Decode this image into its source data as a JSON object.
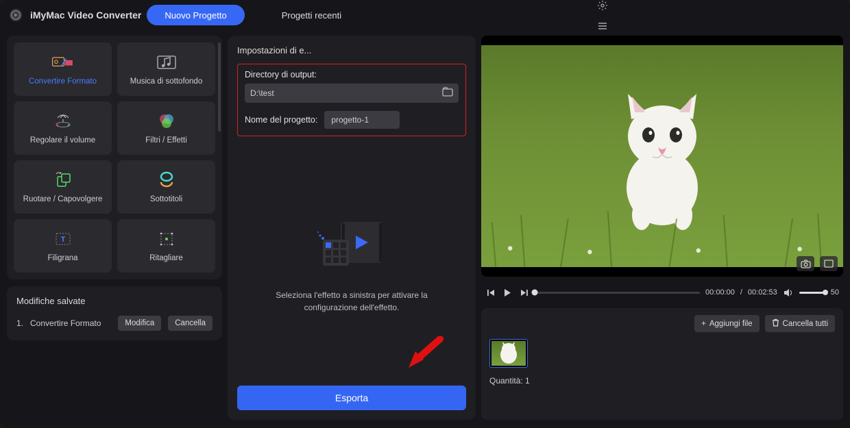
{
  "app": {
    "title": "iMyMac Video Converter"
  },
  "header": {
    "tabs": [
      {
        "label": "Nuovo Progetto",
        "active": true
      },
      {
        "label": "Progetti recenti",
        "active": false
      }
    ]
  },
  "tools": [
    {
      "name": "convert-format",
      "label": "Convertire Formato",
      "active": true
    },
    {
      "name": "background-music",
      "label": "Musica di sottofondo"
    },
    {
      "name": "adjust-volume",
      "label": "Regolare il volume"
    },
    {
      "name": "filters-effects",
      "label": "Filtri / Effetti"
    },
    {
      "name": "rotate-flip",
      "label": "Ruotare / Capovolgere"
    },
    {
      "name": "subtitles",
      "label": "Sottotitoli"
    },
    {
      "name": "watermark",
      "label": "Filigrana"
    },
    {
      "name": "crop",
      "label": "Ritagliare"
    }
  ],
  "saved": {
    "title": "Modifiche salvate",
    "items": [
      {
        "index": "1.",
        "label": "Convertire Formato"
      }
    ],
    "editLabel": "Modifica",
    "deleteLabel": "Cancella"
  },
  "export": {
    "title": "Impostazioni di e...",
    "outputDirLabel": "Directory di output:",
    "outputDir": "D:\\test",
    "projectNameLabel": "Nome del progetto:",
    "projectName": "progetto-1",
    "placeholder": "Seleziona l'effetto a sinistra per attivare la configurazione dell'effetto.",
    "button": "Esporta"
  },
  "player": {
    "currentTime": "00:00:00",
    "duration": "00:02:53",
    "volume": "50"
  },
  "files": {
    "addLabel": "Aggiungi file",
    "clearLabel": "Cancella tutti",
    "qtyLabel": "Quantità:",
    "qty": "1"
  }
}
